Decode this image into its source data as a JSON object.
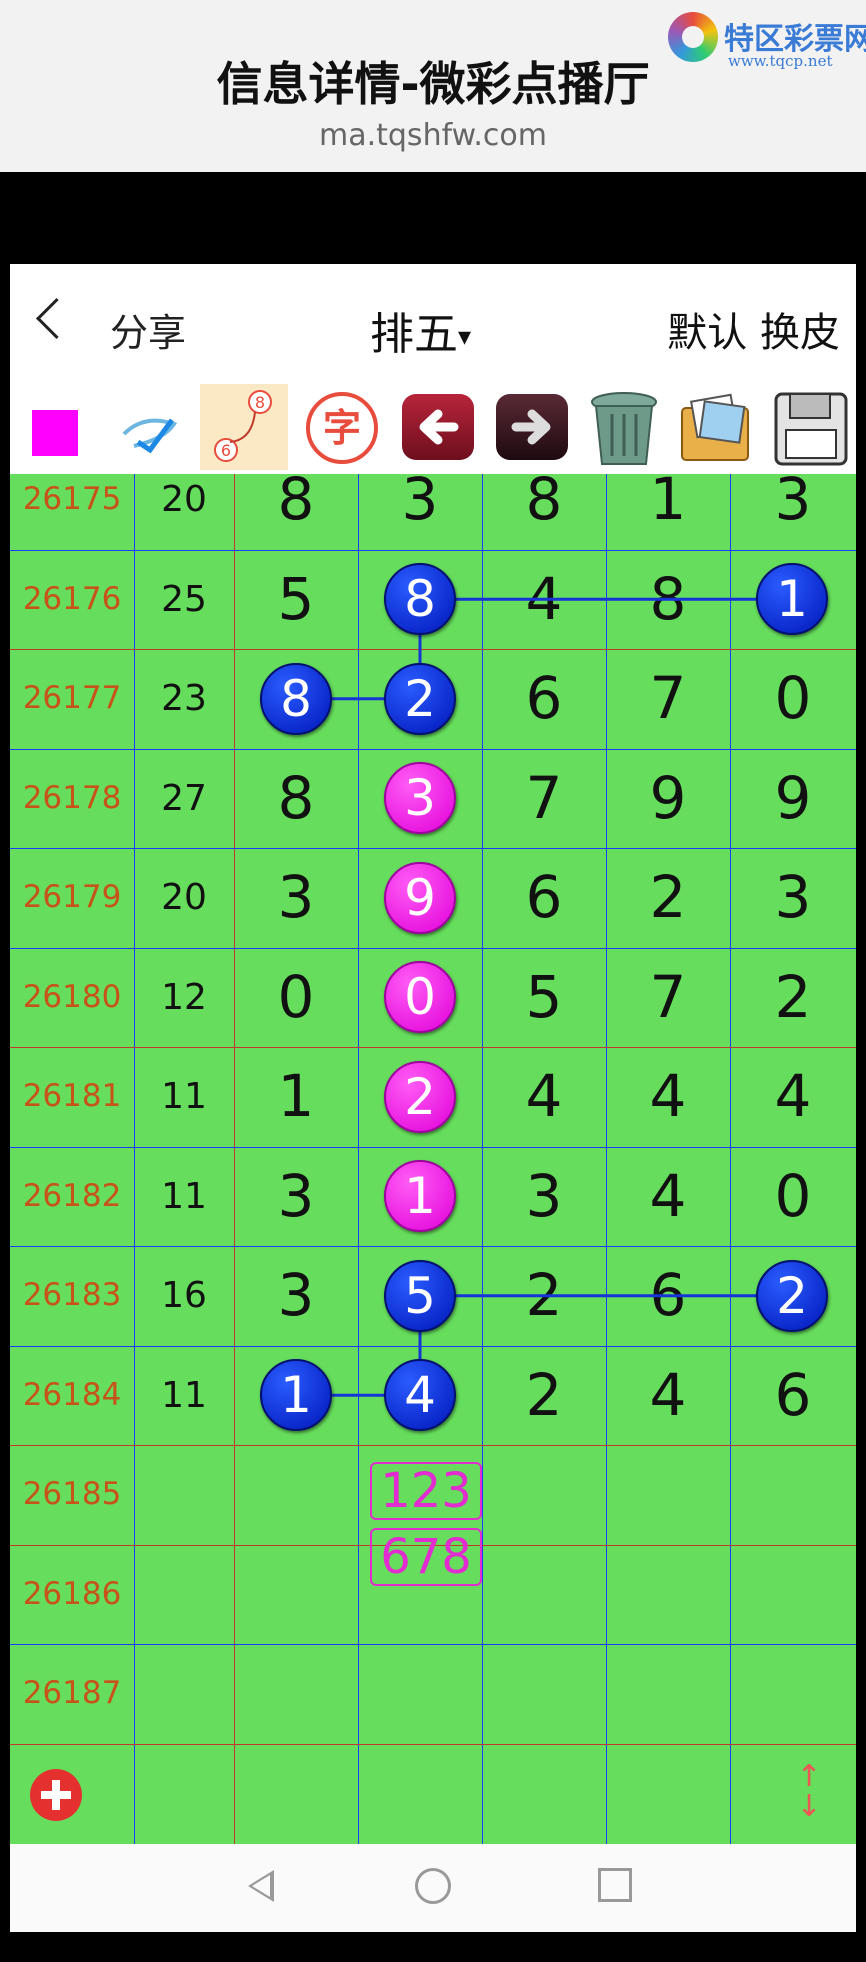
{
  "browser": {
    "title": "信息详情-微彩点播厅",
    "url": "ma.tqshfw.com",
    "logo_text": "特区彩票网",
    "logo_sub": "www.tqcp.net"
  },
  "header": {
    "back_icon": "chevron-left-icon",
    "share_label": "分享",
    "title": "排五",
    "title_caret": "▾",
    "right_label": "默认 换皮"
  },
  "toolbar": {
    "items": [
      "color-swatch",
      "pen-icon",
      "line-connect-icon",
      "text-char-icon",
      "undo-arrow-icon",
      "redo-arrow-icon",
      "trash-icon",
      "gallery-icon",
      "save-icon"
    ],
    "char_label": "字",
    "line_tool_top": "8",
    "line_tool_bottom": "6",
    "swatch_color": "#ff00ff"
  },
  "rows": [
    {
      "period": "26175",
      "sum": "20",
      "digits": [
        "8",
        "3",
        "8",
        "1",
        "3"
      ]
    },
    {
      "period": "26176",
      "sum": "25",
      "digits": [
        "5",
        "8",
        "4",
        "8",
        "1"
      ]
    },
    {
      "period": "26177",
      "sum": "23",
      "digits": [
        "8",
        "2",
        "6",
        "7",
        "0"
      ]
    },
    {
      "period": "26178",
      "sum": "27",
      "digits": [
        "8",
        "3",
        "7",
        "9",
        "9"
      ]
    },
    {
      "period": "26179",
      "sum": "20",
      "digits": [
        "3",
        "9",
        "6",
        "2",
        "3"
      ]
    },
    {
      "period": "26180",
      "sum": "12",
      "digits": [
        "0",
        "0",
        "5",
        "7",
        "2"
      ]
    },
    {
      "period": "26181",
      "sum": "11",
      "digits": [
        "1",
        "2",
        "4",
        "4",
        "4"
      ]
    },
    {
      "period": "26182",
      "sum": "11",
      "digits": [
        "3",
        "1",
        "3",
        "4",
        "0"
      ]
    },
    {
      "period": "26183",
      "sum": "16",
      "digits": [
        "3",
        "5",
        "2",
        "6",
        "2"
      ]
    },
    {
      "period": "26184",
      "sum": "11",
      "digits": [
        "1",
        "4",
        "2",
        "4",
        "6"
      ]
    },
    {
      "period": "26185",
      "sum": "",
      "digits": [
        "",
        "",
        "",
        "",
        ""
      ]
    },
    {
      "period": "26186",
      "sum": "",
      "digits": [
        "",
        "",
        "",
        "",
        ""
      ]
    },
    {
      "period": "26187",
      "sum": "",
      "digits": [
        "",
        "",
        "",
        "",
        ""
      ]
    }
  ],
  "marks": [
    {
      "row": 1,
      "col": 1,
      "color": "blue"
    },
    {
      "row": 1,
      "col": 4,
      "color": "blue"
    },
    {
      "row": 2,
      "col": 0,
      "color": "blue"
    },
    {
      "row": 2,
      "col": 1,
      "color": "blue"
    },
    {
      "row": 3,
      "col": 1,
      "color": "pink"
    },
    {
      "row": 4,
      "col": 1,
      "color": "pink"
    },
    {
      "row": 5,
      "col": 1,
      "color": "pink"
    },
    {
      "row": 6,
      "col": 1,
      "color": "pink"
    },
    {
      "row": 7,
      "col": 1,
      "color": "pink"
    },
    {
      "row": 8,
      "col": 1,
      "color": "blue"
    },
    {
      "row": 8,
      "col": 4,
      "color": "blue"
    },
    {
      "row": 9,
      "col": 0,
      "color": "blue"
    },
    {
      "row": 9,
      "col": 1,
      "color": "blue"
    }
  ],
  "links": [
    {
      "from": [
        1,
        1
      ],
      "to": [
        1,
        4
      ]
    },
    {
      "from": [
        1,
        1
      ],
      "to": [
        2,
        1
      ]
    },
    {
      "from": [
        2,
        0
      ],
      "to": [
        2,
        1
      ]
    },
    {
      "from": [
        8,
        1
      ],
      "to": [
        8,
        4
      ]
    },
    {
      "from": [
        8,
        1
      ],
      "to": [
        9,
        1
      ]
    },
    {
      "from": [
        9,
        0
      ],
      "to": [
        9,
        1
      ]
    }
  ],
  "predictions": [
    "123",
    "678"
  ],
  "colors": {
    "grid_bg": "#66dd5c",
    "period_text": "#c8531a",
    "blue_line": "#1a3cff",
    "red_line": "#c0392b"
  },
  "footer": {
    "add_icon": "plus-circle-icon",
    "scroll_icon": "up-down-arrow-icon"
  },
  "navbar": {
    "items": [
      "nav-back-icon",
      "nav-home-icon",
      "nav-recent-icon"
    ]
  }
}
